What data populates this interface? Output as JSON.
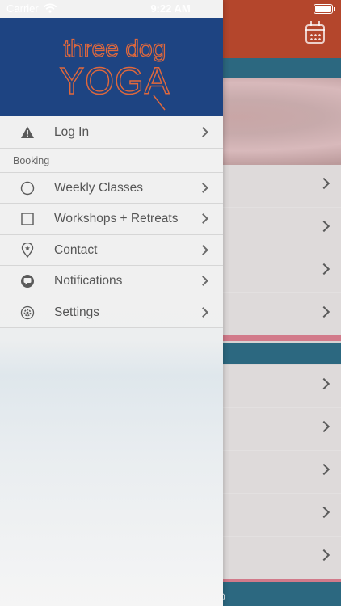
{
  "status_bar": {
    "carrier": "Carrier",
    "time": "9:22 AM"
  },
  "brand": {
    "logo_line1": "three dog",
    "logo_line2": "YOGA"
  },
  "menu": {
    "login_label": "Log In",
    "section_booking": "Booking",
    "items": [
      {
        "label": "Weekly Classes",
        "icon": "circle-icon"
      },
      {
        "label": "Workshops + Retreats",
        "icon": "square-icon"
      },
      {
        "label": "Contact",
        "icon": "location-pin-icon"
      },
      {
        "label": "Notifications",
        "icon": "chat-bubble-icon"
      },
      {
        "label": "Settings",
        "icon": "gear-icon"
      }
    ]
  },
  "background_app": {
    "footer_text": "0"
  },
  "colors": {
    "drawer_header": "#1e4482",
    "logo": "#e0683c",
    "app_header": "#b4462c",
    "band": "#2c6880"
  }
}
